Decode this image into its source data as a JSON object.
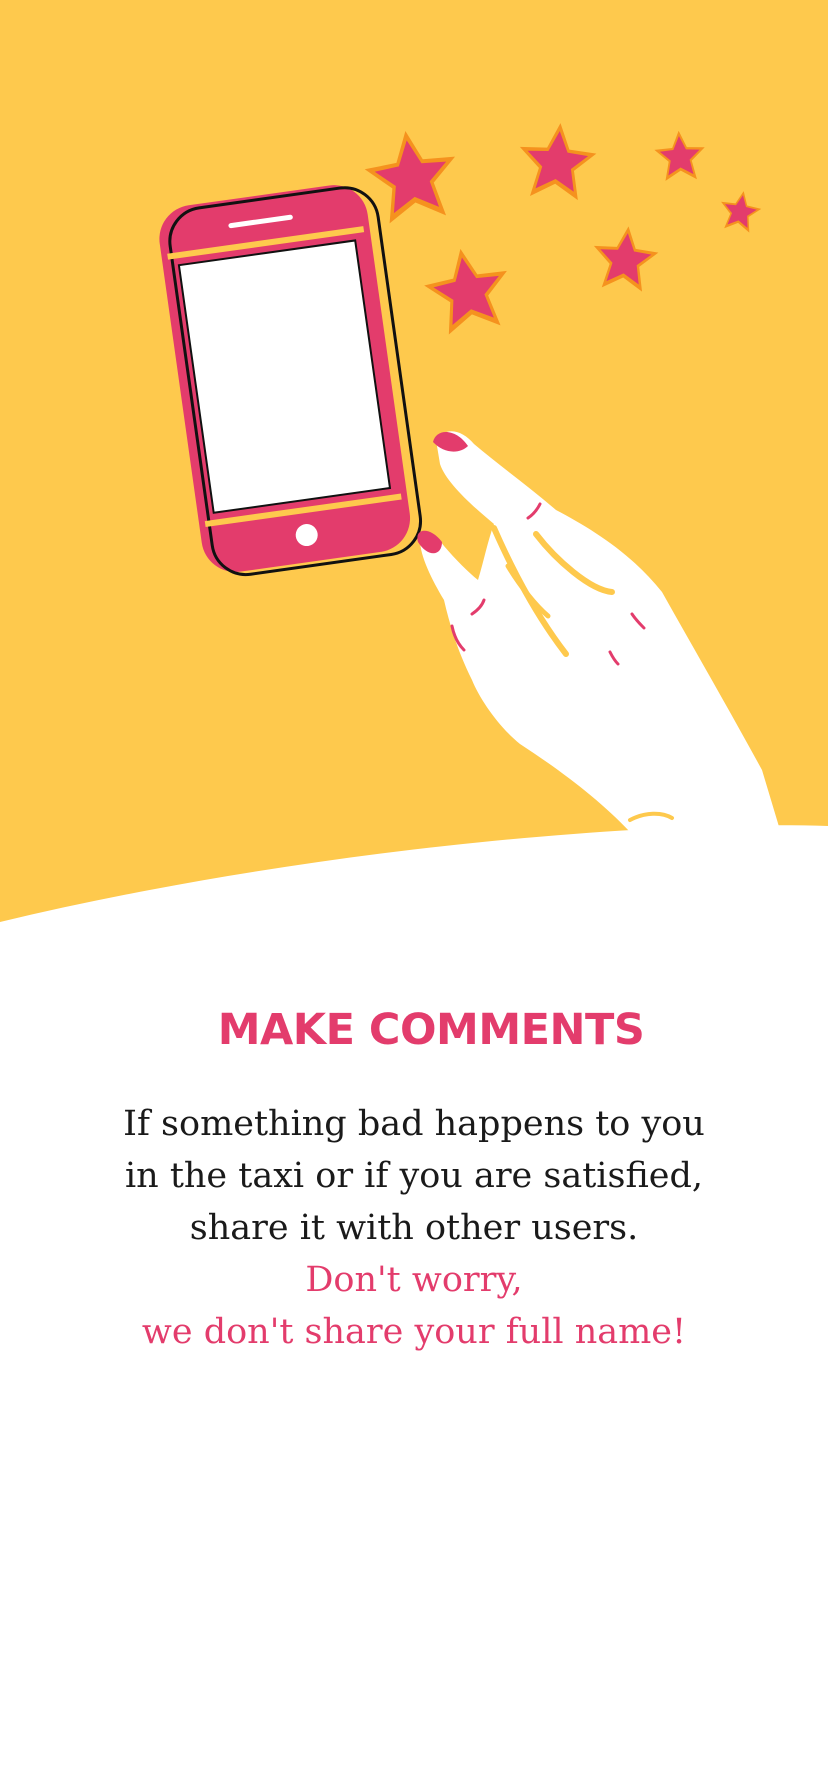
{
  "colors": {
    "background_top": "#fec94d",
    "accent_pink": "#e33c6c",
    "star_orange": "#f5921e",
    "body_text": "#1a1a1a",
    "background": "#ffffff"
  },
  "illustration": {
    "icons": [
      "phone-icon",
      "hand-icon",
      "star-icon"
    ]
  },
  "onboarding": {
    "title": "MAKE COMMENTS",
    "description_lines": [
      "If something bad happens to you",
      "in the taxi or if you are satisfied,",
      "share it with other users."
    ],
    "note_lines": [
      "Don't worry,",
      "we don't share your full name!"
    ]
  }
}
